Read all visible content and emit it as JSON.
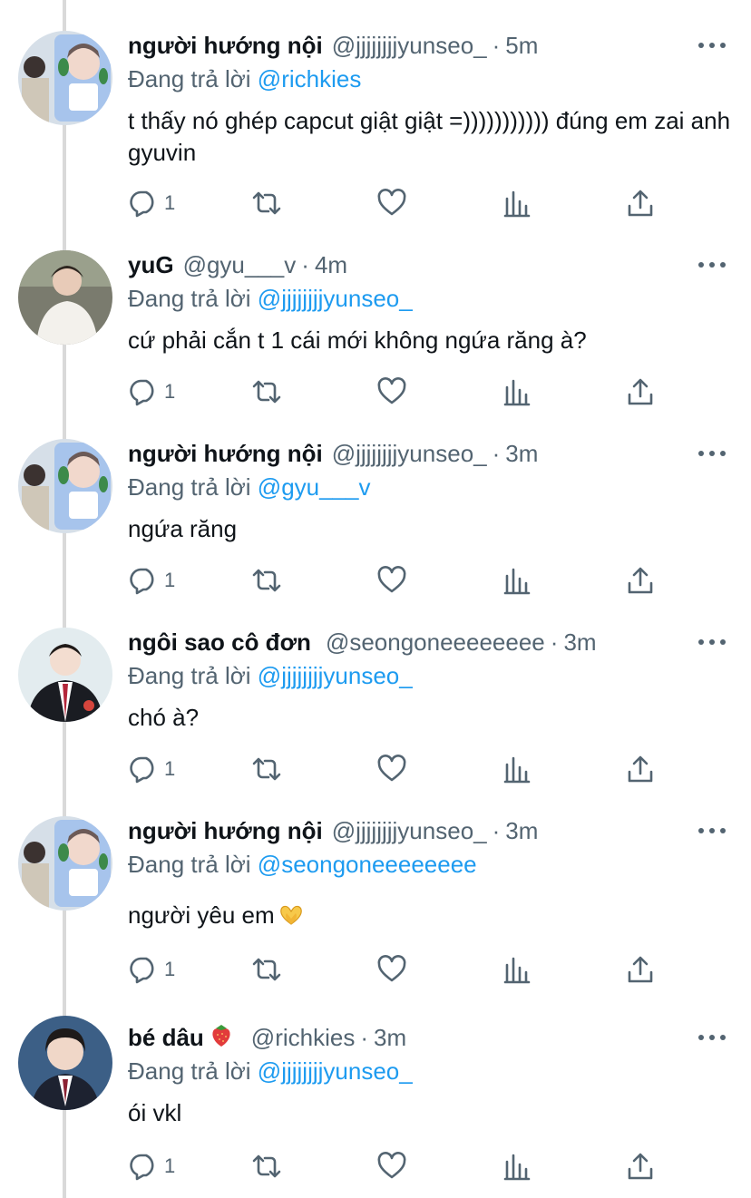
{
  "tweets": [
    {
      "name": "người hướng nội",
      "name_emoji": "",
      "handle": "@jjjjjjjjyunseo_",
      "time": "5m",
      "reply_prefix": "Đang trả lời",
      "reply_to": "@richkies",
      "text": "t thấy nó ghép capcut giật giật =))))))))))) đúng em zai anh gyuvin",
      "text_emoji": "",
      "reply_count": "1",
      "avatar": "avatar-yunseo"
    },
    {
      "name": "yuG",
      "name_emoji": "",
      "handle": "@gyu___v",
      "time": "4m",
      "reply_prefix": "Đang trả lời",
      "reply_to": "@jjjjjjjjyunseo_",
      "text": "cứ phải cắn t 1 cái mới không ngứa răng à?",
      "text_emoji": "",
      "reply_count": "1",
      "avatar": "avatar-gyuv"
    },
    {
      "name": "người hướng nội",
      "name_emoji": "",
      "handle": "@jjjjjjjjyunseo_",
      "time": "3m",
      "reply_prefix": "Đang trả lời",
      "reply_to": "@gyu___v",
      "text": "ngứa răng",
      "text_emoji": "",
      "reply_count": "1",
      "avatar": "avatar-yunseo"
    },
    {
      "name": "ngôi sao cô đơn",
      "name_emoji": "",
      "handle": "@seongoneeeeeeee",
      "time": "3m",
      "reply_prefix": "Đang trả lời",
      "reply_to": "@jjjjjjjjyunseo_",
      "text": "chó à?",
      "text_emoji": "",
      "reply_count": "1",
      "avatar": "avatar-seongone"
    },
    {
      "name": "người hướng nội",
      "name_emoji": "",
      "handle": "@jjjjjjjjyunseo_",
      "time": "3m",
      "reply_prefix": "Đang trả lời",
      "reply_to": "@seongoneeeeeeee",
      "text": "người yêu em",
      "text_emoji": "heart-hands-emoji",
      "reply_count": "1",
      "avatar": "avatar-yunseo"
    },
    {
      "name": "bé dâu",
      "name_emoji": "strawberry-emoji",
      "handle": "@richkies",
      "time": "3m",
      "reply_prefix": "Đang trả lời",
      "reply_to": "@jjjjjjjjyunseo_",
      "text": "ói vkl",
      "text_emoji": "",
      "reply_count": "1",
      "avatar": "avatar-richkies"
    }
  ],
  "separator": "·",
  "icons": {
    "reply": "reply-icon",
    "retweet": "retweet-icon",
    "like": "heart-icon",
    "stats": "stats-icon",
    "share": "share-icon",
    "more": "more-options-icon"
  },
  "colors": {
    "mention": "#1d9bf0",
    "secondary_text": "#536471",
    "primary_text": "#0f1419",
    "thread_line": "#d9d9d9"
  }
}
